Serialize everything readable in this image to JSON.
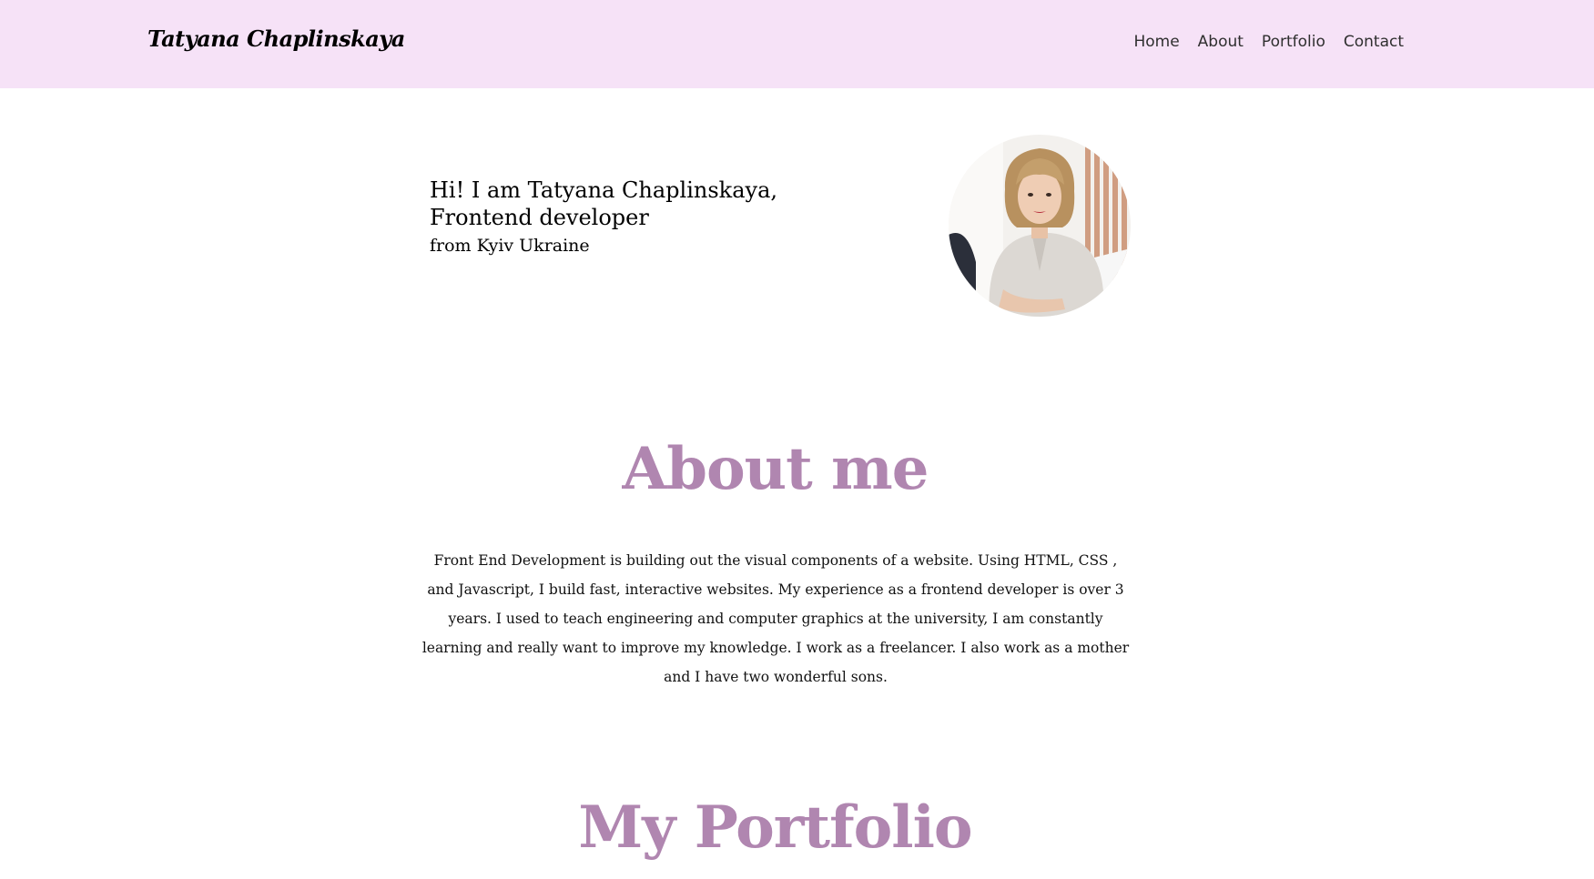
{
  "header": {
    "brand": "Tatyana Chaplinskaya",
    "nav": [
      {
        "label": "Home"
      },
      {
        "label": "About"
      },
      {
        "label": "Portfolio"
      },
      {
        "label": "Contact"
      }
    ]
  },
  "hero": {
    "greeting_line1": "Hi! I am Tatyana Chaplinskaya,",
    "greeting_line2": "Frontend developer",
    "location": "from Kyiv Ukraine"
  },
  "about": {
    "title": "About me",
    "text": "Front End Development is building out the visual components of a website. Using HTML, CSS , and Javascript, I build fast, interactive websites. My experience as a frontend developer is over 3 years. I used to teach engineering and computer graphics at the university, I am constantly learning and really want to improve my knowledge. I work as a freelancer. I also work as a mother and I have two wonderful sons."
  },
  "portfolio": {
    "title": "My Portfolio"
  },
  "colors": {
    "header_bg": "#f6e2f7",
    "accent": "#b086b0",
    "nav_text": "#2f2f2f"
  },
  "icons": {
    "avatar": "profile-photo"
  }
}
